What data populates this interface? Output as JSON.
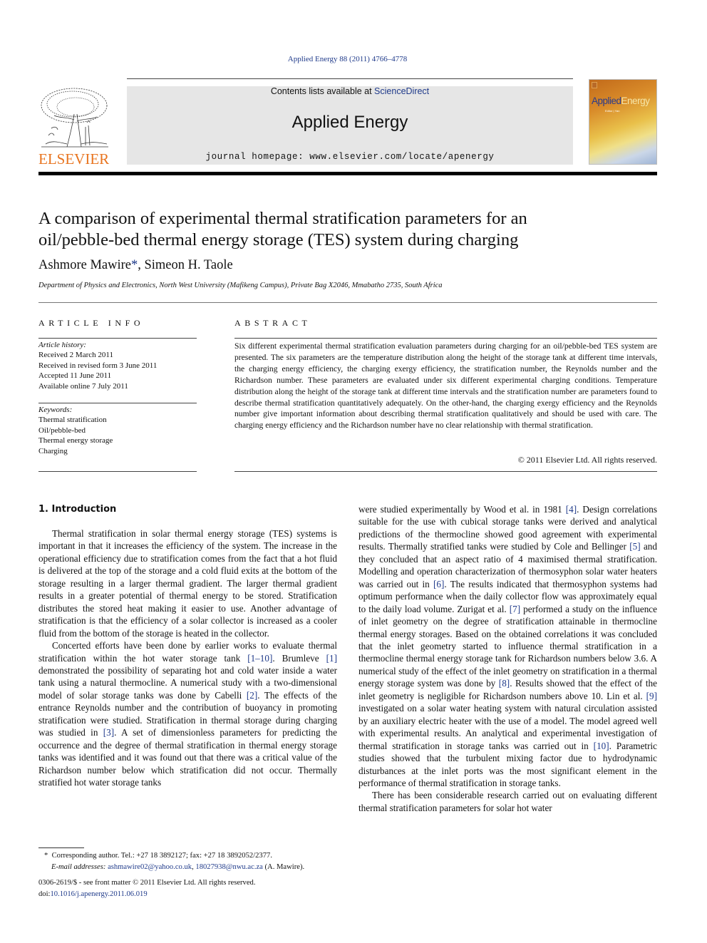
{
  "header": {
    "journal_ref": "Applied Energy 88 (2011) 4766–4778",
    "contents_prefix": "Contents lists available at ",
    "contents_link": "ScienceDirect",
    "journal_title": "Applied Energy",
    "homepage": "journal homepage: www.elsevier.com/locate/apenergy",
    "publisher_logo_text": "ELSEVIER",
    "cover": {
      "title_a": "Applied",
      "title_b": "Energy",
      "subtitle": "Editor | Yan"
    }
  },
  "article": {
    "title_line1": "A comparison of experimental thermal stratification parameters for an",
    "title_line2": "oil/pebble-bed thermal energy storage (TES) system during charging",
    "author1": "Ashmore Mawire",
    "author1_mark": "*",
    "author_sep": ", ",
    "author2": "Simeon H. Taole",
    "affiliation": "Department of Physics and Electronics, North West University (Mafikeng Campus), Private Bag X2046, Mmabatho 2735, South Africa"
  },
  "article_info": {
    "heading": "ARTICLE INFO",
    "history_label": "Article history:",
    "history": [
      "Received 2 March 2011",
      "Received in revised form 3 June 2011",
      "Accepted 11 June 2011",
      "Available online 7 July 2011"
    ],
    "keywords_label": "Keywords:",
    "keywords": [
      "Thermal stratification",
      "Oil/pebble-bed",
      "Thermal energy storage",
      "Charging"
    ]
  },
  "abstract": {
    "heading": "ABSTRACT",
    "text": "Six different experimental thermal stratification evaluation parameters during charging for an oil/pebble-bed TES system are presented. The six parameters are the temperature distribution along the height of the storage tank at different time intervals, the charging energy efficiency, the charging exergy efficiency, the stratification number, the Reynolds number and the Richardson number. These parameters are evaluated under six different experimental charging conditions. Temperature distribution along the height of the storage tank at different time intervals and the stratification number are parameters found to describe thermal stratification quantitatively adequately. On the other-hand, the charging exergy efficiency and the Reynolds number give important information about describing thermal stratification qualitatively and should be used with care. The charging energy efficiency and the Richardson number have no clear relationship with thermal stratification.",
    "copyright": "© 2011 Elsevier Ltd. All rights reserved."
  },
  "body": {
    "section_heading": "1. Introduction",
    "p1": "Thermal stratification in solar thermal energy storage (TES) systems is important in that it increases the efficiency of the system. The increase in the operational efficiency due to stratification comes from the fact that a hot fluid is delivered at the top of the storage and a cold fluid exits at the bottom of the storage resulting in a larger thermal gradient. The larger thermal gradient results in a greater potential of thermal energy to be stored. Stratification distributes the stored heat making it easier to use. Another advantage of stratification is that the efficiency of a solar collector is increased as a cooler fluid from the bottom of the storage is heated in the collector.",
    "p2": {
      "t1": "Concerted efforts have been done by earlier works to evaluate thermal stratification within the hot water storage tank ",
      "c1": "[1–10]",
      "t2": ". Brumleve ",
      "c2": "[1]",
      "t3": " demonstrated the possibility of separating hot and cold water inside a water tank using a natural thermocline. A numerical study with a two-dimensional model of solar storage tanks was done by Cabelli ",
      "c3": "[2]",
      "t4": ". The effects of the entrance Reynolds number and the contribution of buoyancy in promoting stratification were studied. Stratification in thermal storage during charging was studied in ",
      "c4": "[3]",
      "t5": ". A set of dimensionless parameters for predicting the occurrence and the degree of thermal stratification in thermal energy storage tanks was identified and it was found out that there was a critical value of the Richardson number below which stratification did not occur. Thermally stratified hot water storage tanks"
    },
    "p3": {
      "t1": "were studied experimentally by Wood et al. in 1981 ",
      "c1": "[4]",
      "t2": ". Design correlations suitable for the use with cubical storage tanks were derived and analytical predictions of the thermocline showed good agreement with experimental results. Thermally stratified tanks were studied by Cole and Bellinger ",
      "c2": "[5]",
      "t3": " and they concluded that an aspect ratio of 4 maximised thermal stratification. Modelling and operation characterization of thermosyphon solar water heaters was carried out in ",
      "c3": "[6]",
      "t4": ". The results indicated that thermosyphon systems had optimum performance when the daily collector flow was approximately equal to the daily load volume. Zurigat et al. ",
      "c4": "[7]",
      "t5": " performed a study on the influence of inlet geometry on the degree of stratification attainable in thermocline thermal energy storages. Based on the obtained correlations it was concluded that the inlet geometry started to influence thermal stratification in a thermocline thermal energy storage tank for Richardson numbers below 3.6. A numerical study of the effect of the inlet geometry on stratification in a thermal energy storage system was done by ",
      "c5": "[8]",
      "t6": ". Results showed that the effect of the inlet geometry is negligible for Richardson numbers above 10. Lin et al. ",
      "c6": "[9]",
      "t7": " investigated on a solar water heating system with natural circulation assisted by an auxiliary electric heater with the use of a model. The model agreed well with experimental results. An analytical and experimental investigation of thermal stratification in storage tanks was carried out in ",
      "c7": "[10]",
      "t8": ". Parametric studies showed that the turbulent mixing factor due to hydrodynamic disturbances at the inlet ports was the most significant element in the performance of thermal stratification in storage tanks."
    },
    "p4": "There has been considerable research carried out on evaluating different thermal stratification parameters for solar hot water"
  },
  "footnote": {
    "mark": "*",
    "line1": "Corresponding author. Tel.: +27 18 3892127; fax: +27 18 3892052/2377.",
    "email_label": "E-mail addresses:",
    "email1": "ashmawire02@yahoo.co.uk",
    "email_sep": ", ",
    "email2": "18027938@nwu.ac.za",
    "email_owner": " (A. Mawire)."
  },
  "front_matter": {
    "issn_line": "0306-2619/$ - see front matter © 2011 Elsevier Ltd. All rights reserved.",
    "doi_prefix": "doi:",
    "doi": "10.1016/j.apenergy.2011.06.019"
  }
}
